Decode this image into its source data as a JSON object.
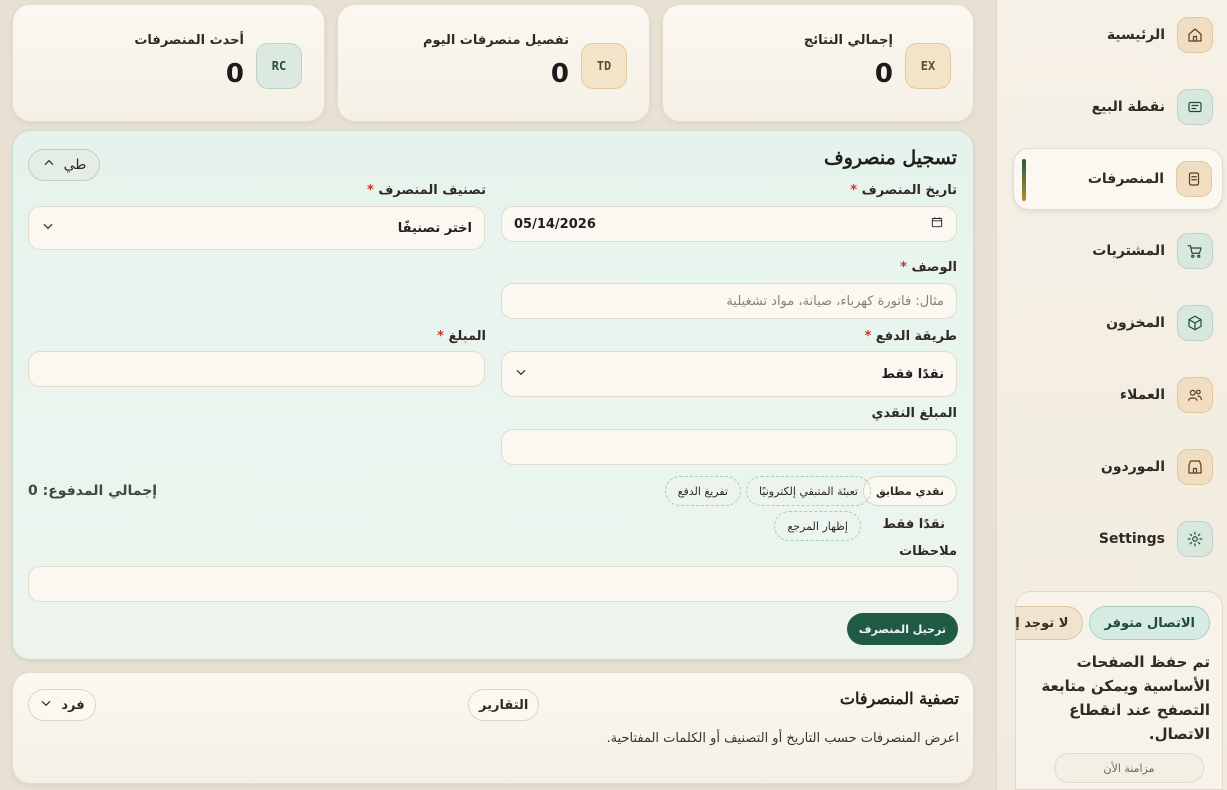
{
  "sidebar": {
    "items": [
      {
        "label": "الرئيسية",
        "icon": "home-icon"
      },
      {
        "label": "نقطة البيع",
        "icon": "pos-icon"
      },
      {
        "label": "المنصرفات",
        "icon": "receipt-icon"
      },
      {
        "label": "المشتريات",
        "icon": "cart-icon"
      },
      {
        "label": "المخزون",
        "icon": "box-icon"
      },
      {
        "label": "العملاء",
        "icon": "users-icon"
      },
      {
        "label": "الموردون",
        "icon": "store-icon"
      },
      {
        "label": "Settings",
        "icon": "gear-icon"
      }
    ],
    "status": {
      "online_label": "الاتصال متوفر",
      "pending_label": "لا توجد إج",
      "message": "تم حفظ الصفحات الأساسية ويمكن متابعة التصفح عند انقطاع الاتصال.",
      "sync_label": "مزامنة الأن"
    }
  },
  "stats": [
    {
      "title": "إجمالي النتائج",
      "value": "0",
      "badge": "EX"
    },
    {
      "title": "تفصيل منصرفات اليوم",
      "value": "0",
      "badge": "TD"
    },
    {
      "title": "أحدث المنصرفات",
      "value": "0",
      "badge": "RC"
    }
  ],
  "form": {
    "title": "تسجيل منصروف",
    "collapse_label": "طي",
    "date_label": "تاريخ المنصرف",
    "date_value": "05/14/2026",
    "category_label": "تصنيف المنصرف",
    "category_value": "اختر تصنيفًا",
    "description_label": "الوصف",
    "description_placeholder": "مثال: فاتورة كهرباء، صيانة، مواد تشغيلية",
    "payment_label": "طريقة الدفع",
    "payment_value": "نقدًا فقط",
    "amount_label": "المبلغ",
    "cash_label": "المبلغ النقدي",
    "chips": [
      "نقدي مطابق",
      "تعبئة المتبقي إلكترونيًا",
      "تفريغ الدفع",
      "إظهار المرجع"
    ],
    "cash_only": "نقدًا فقط",
    "total_paid": "إجمالي المدفوع: 0",
    "notes_label": "ملاحظات",
    "required_mark": "*",
    "submit_label": "ترحيل المنصرف"
  },
  "filter": {
    "title": "تصفية المنصرفات",
    "description": "اعرض المنصرفات حسب التاريخ أو التصنيف أو الكلمات المفتاحية.",
    "reports_label": "التقارير",
    "mode_label": "فرد"
  }
}
